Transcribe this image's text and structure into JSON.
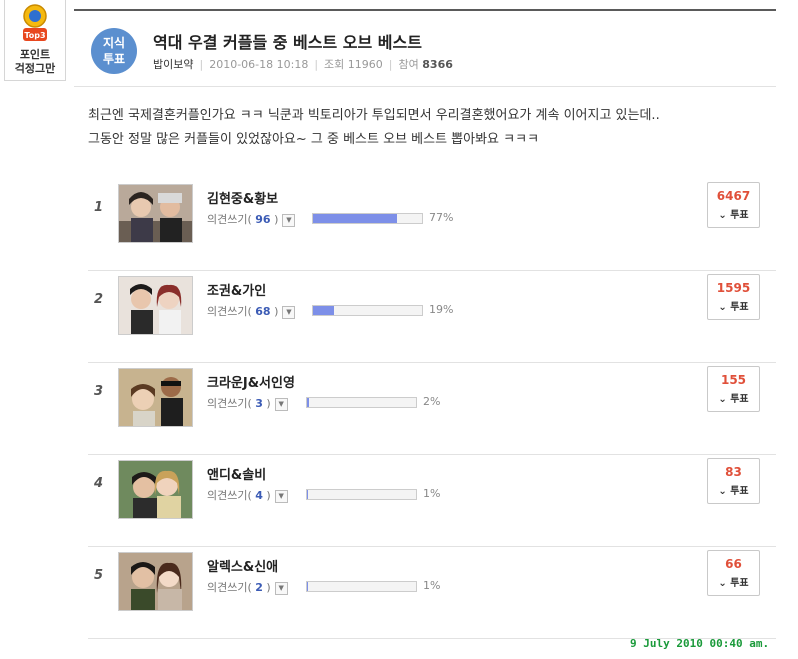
{
  "badge": {
    "line1": "포인트",
    "line2": "걱정그만",
    "icon": "top3-medal-icon"
  },
  "poll": {
    "icon_line1": "지식",
    "icon_line2": "투표",
    "title": "역대 우결 커플들 중 베스트 오브 베스트",
    "author": "밥이보약",
    "datetime": "2010-06-18 10:18",
    "views_label": "조회",
    "views": "11960",
    "participants_label": "참여",
    "participants": "8366"
  },
  "description": {
    "line1": "최근엔 국제결혼커플인가요 ㅋㅋ 닉쿤과 빅토리아가 투입되면서 우리결혼했어요가 계속 이어지고 있는데..",
    "line2": "그동안 정말 많은 커플들이 있었잖아요~ 그 중 베스트 오브 베스트 뽑아봐요 ㅋㅋㅋ"
  },
  "items": [
    {
      "rank": "1",
      "name": "김현중&황보",
      "comment_label": "의견쓰기",
      "comments": "96",
      "percent": "77%",
      "share": 0.77,
      "votes": "6467",
      "vote_label": "투표"
    },
    {
      "rank": "2",
      "name": "조권&가인",
      "comment_label": "의견쓰기",
      "comments": "68",
      "percent": "19%",
      "share": 0.19,
      "votes": "1595",
      "vote_label": "투표"
    },
    {
      "rank": "3",
      "name": "크라운J&서인영",
      "comment_label": "의견쓰기",
      "comments": "3",
      "percent": "2%",
      "share": 0.02,
      "votes": "155",
      "vote_label": "투표"
    },
    {
      "rank": "4",
      "name": "앤디&솔비",
      "comment_label": "의견쓰기",
      "comments": "4",
      "percent": "1%",
      "share": 0.01,
      "votes": "83",
      "vote_label": "투표"
    },
    {
      "rank": "5",
      "name": "알렉스&신애",
      "comment_label": "의견쓰기",
      "comments": "2",
      "percent": "1%",
      "share": 0.01,
      "votes": "66",
      "vote_label": "투표"
    }
  ],
  "timestamp": "9 July 2010  00:40 am.",
  "colors": {
    "accent": "#5b8fcf",
    "bar_fill": "#7d8fe8",
    "vote_count": "#e0503a",
    "timestamp": "#1a9a3a"
  }
}
